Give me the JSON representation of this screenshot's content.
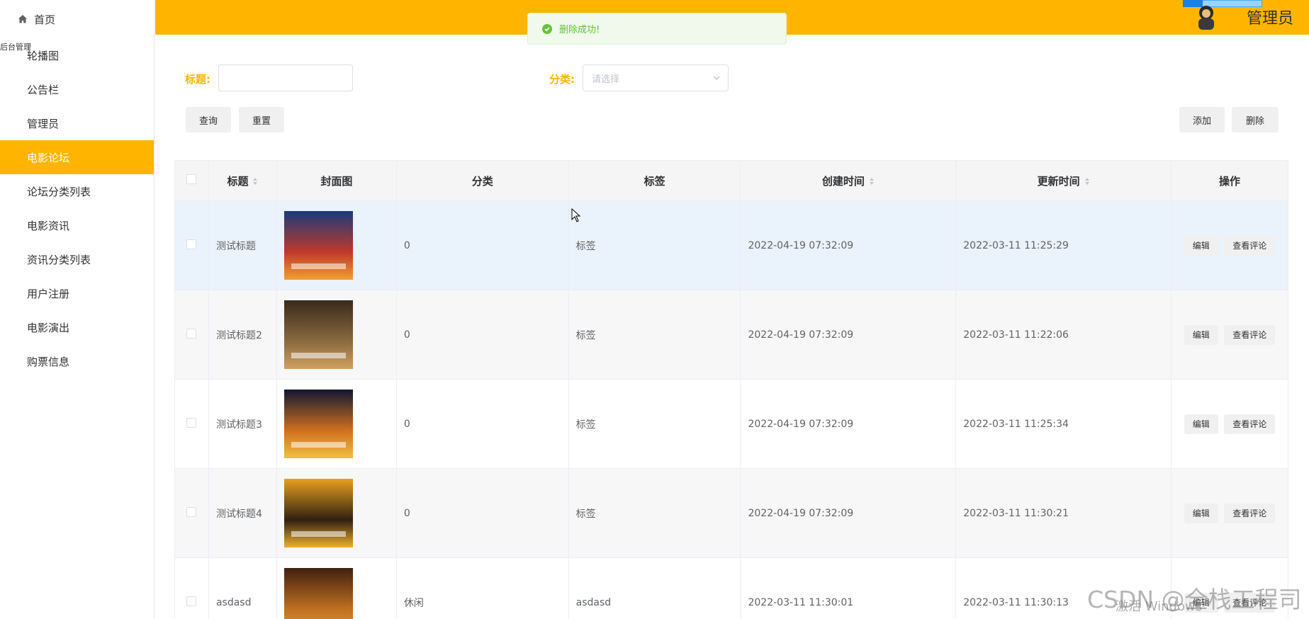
{
  "sidebar": {
    "home_label": "首页",
    "stray_label": "后台管理",
    "items": [
      {
        "label": "轮播图",
        "active": false
      },
      {
        "label": "公告栏",
        "active": false
      },
      {
        "label": "管理员",
        "active": false
      },
      {
        "label": "电影论坛",
        "active": true
      },
      {
        "label": "论坛分类列表",
        "active": false
      },
      {
        "label": "电影资讯",
        "active": false
      },
      {
        "label": "资讯分类列表",
        "active": false
      },
      {
        "label": "用户注册",
        "active": false
      },
      {
        "label": "电影演出",
        "active": false
      },
      {
        "label": "购票信息",
        "active": false
      }
    ]
  },
  "header": {
    "user_label": "管理员",
    "accent_color": "#ffb400"
  },
  "toast": {
    "message": "删除成功!",
    "type": "success"
  },
  "search": {
    "title_label": "标题:",
    "title_value": "",
    "category_label": "分类:",
    "category_placeholder": "请选择"
  },
  "buttons": {
    "query": "查询",
    "reset": "重置",
    "add": "添加",
    "delete": "删除"
  },
  "table": {
    "columns": [
      "标题",
      "封面图",
      "分类",
      "标签",
      "创建时间",
      "更新时间",
      "操作"
    ],
    "rows": [
      {
        "title": "测试标题",
        "category": "0",
        "tag": "标签",
        "created": "2022-04-19 07:32:09",
        "updated": "2022-03-11 11:25:29",
        "poster_colors": [
          "#1a3a7a",
          "#c0392b",
          "#f0a030"
        ]
      },
      {
        "title": "测试标题2",
        "category": "0",
        "tag": "标签",
        "created": "2022-04-19 07:32:09",
        "updated": "2022-03-11 11:22:06",
        "poster_colors": [
          "#3a2a1a",
          "#8a6a40",
          "#d0a060"
        ]
      },
      {
        "title": "测试标题3",
        "category": "0",
        "tag": "标签",
        "created": "2022-04-19 07:32:09",
        "updated": "2022-03-11 11:25:34",
        "poster_colors": [
          "#101830",
          "#d07020",
          "#f0c040"
        ]
      },
      {
        "title": "测试标题4",
        "category": "0",
        "tag": "标签",
        "created": "2022-04-19 07:32:09",
        "updated": "2022-03-11 11:30:21",
        "poster_colors": [
          "#e8a020",
          "#302010",
          "#f0b030"
        ]
      },
      {
        "title": "asdasd",
        "category": "休闲",
        "tag": "asdasd",
        "created": "2022-03-11 11:30:01",
        "updated": "2022-03-11 11:30:13",
        "poster_colors": [
          "#402010",
          "#c07020",
          "#e0a040"
        ]
      }
    ],
    "edit_label": "编辑",
    "comments_label": "查看评论"
  },
  "watermark": {
    "csdn": "CSDN @全栈工程司",
    "windows": "激活 Windows"
  }
}
